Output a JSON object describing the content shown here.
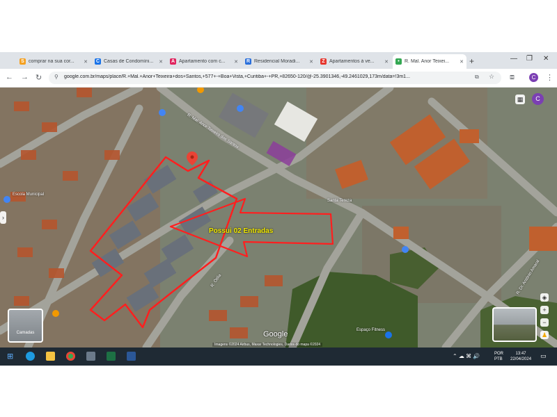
{
  "browser": {
    "tabs": [
      {
        "title": "comprar na sua cor...",
        "favicon_color": "#f4a020",
        "favicon_glyph": "S"
      },
      {
        "title": "Casas de Condomíni...",
        "favicon_color": "#1a73e8",
        "favicon_glyph": "C"
      },
      {
        "title": "Apartamento com c...",
        "favicon_color": "#e0245e",
        "favicon_glyph": "A"
      },
      {
        "title": "Residencial Moradi...",
        "favicon_color": "#2a6fdb",
        "favicon_glyph": "R"
      },
      {
        "title": "Apartamentos à ve...",
        "favicon_color": "#e6362d",
        "favicon_glyph": "Z"
      },
      {
        "title": "R. Mal. Anor Teixei...",
        "favicon_color": "#34a853",
        "favicon_glyph": "•"
      }
    ],
    "active_tab": 5,
    "new_tab_icon": "+",
    "url": "google.com.br/maps/place/R.+Mal.+Anor+Teixeira+dos+Santos,+577+-+Boa+Vista,+Curitiba+-+PR,+82650-120/@-25.3901346,-49.2461029,173m/data=!3m1...",
    "profile_initial": "C"
  },
  "map": {
    "annotation_text": "Possui 02 Entradas",
    "streetview_label": "Camadas",
    "google_logo": "Google",
    "attribution": "Imagens ©2024 Airbus, Maxar Technologies, Dados do mapa ©2024",
    "street_labels": [
      "R. Mal. Anor Teixeira dos Santos",
      "R. Dr. Antônio Amaral",
      "R. Ótilia"
    ],
    "place_labels": [
      "Escola Municipal",
      "Santa Tereza",
      "Espaço Fitness"
    ],
    "annotation_color": "#ff1f1f"
  },
  "taskbar": {
    "lang": [
      "POR",
      "PTB"
    ],
    "time": "13:47",
    "date": "22/04/2024"
  }
}
